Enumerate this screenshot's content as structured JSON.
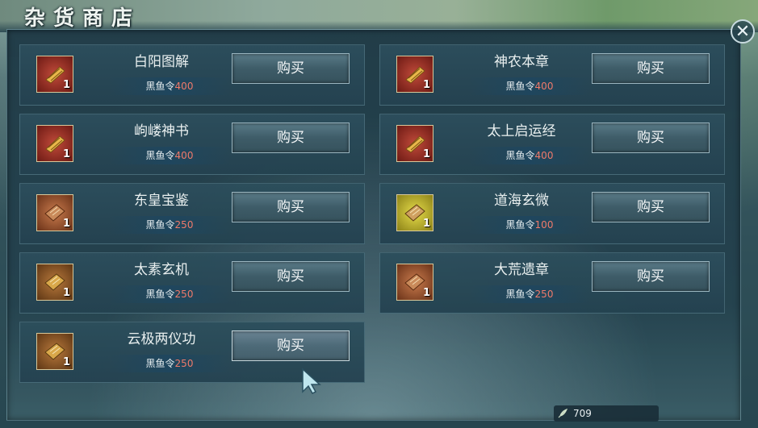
{
  "window": {
    "title": "杂货商店",
    "close_glyph": "✕"
  },
  "currency_name": "黑鱼令",
  "buy_label": "购买",
  "items": [
    {
      "name": "白阳图解",
      "price": "400",
      "qty": "1",
      "icon": "scroll-icon",
      "color": "red"
    },
    {
      "name": "神农本章",
      "price": "400",
      "qty": "1",
      "icon": "scroll-icon",
      "color": "red"
    },
    {
      "name": "岣嵝神书",
      "price": "400",
      "qty": "1",
      "icon": "scroll-icon",
      "color": "red"
    },
    {
      "name": "太上启运经",
      "price": "400",
      "qty": "1",
      "icon": "scroll-icon",
      "color": "red"
    },
    {
      "name": "东皇宝鉴",
      "price": "250",
      "qty": "1",
      "icon": "book-icon",
      "color": "orange"
    },
    {
      "name": "道海玄微",
      "price": "100",
      "qty": "1",
      "icon": "book-icon",
      "color": "yellow"
    },
    {
      "name": "太素玄机",
      "price": "250",
      "qty": "1",
      "icon": "book-icon",
      "color": "brown"
    },
    {
      "name": "大荒遗章",
      "price": "250",
      "qty": "1",
      "icon": "book-icon",
      "color": "orange"
    },
    {
      "name": "云极两仪功",
      "price": "250",
      "qty": "1",
      "icon": "book-icon",
      "color": "brown"
    }
  ],
  "balance": {
    "value": "709",
    "icon": "feather-icon"
  }
}
